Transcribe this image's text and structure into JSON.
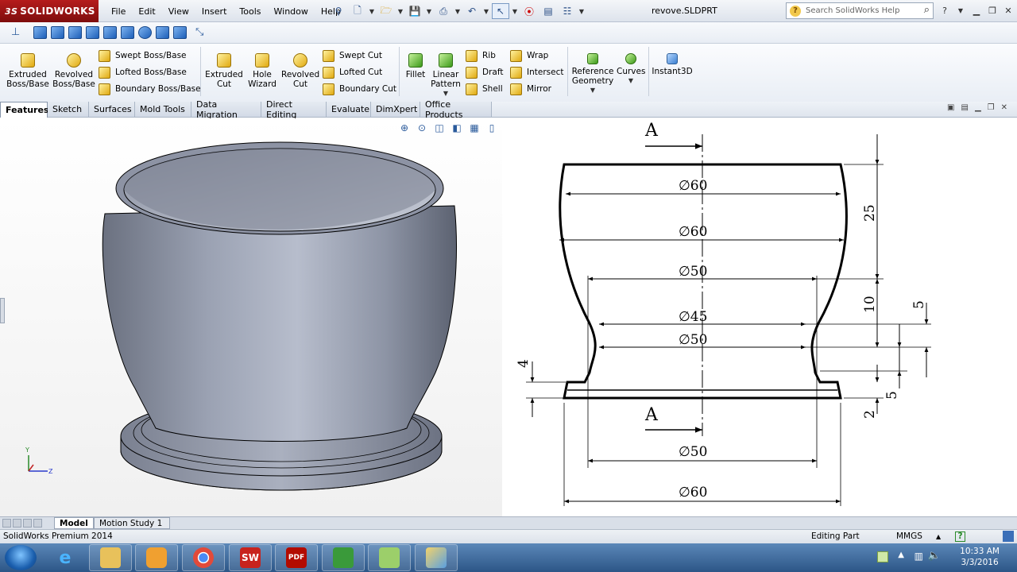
{
  "app": {
    "logo": "SOLIDWORKS",
    "logo_prefix": "3S",
    "document_title": "revove.SLDPRT",
    "search_placeholder": "Search SolidWorks Help"
  },
  "menu": [
    "File",
    "Edit",
    "View",
    "Insert",
    "Tools",
    "Window",
    "Help"
  ],
  "features_toolbar": {
    "extruded_boss": "Extruded Boss/Base",
    "revolved_boss": "Revolved Boss/Base",
    "swept_boss": "Swept Boss/Base",
    "lofted_boss": "Lofted Boss/Base",
    "boundary_boss": "Boundary Boss/Base",
    "extruded_cut": "Extruded Cut",
    "hole_wizard": "Hole Wizard",
    "revolved_cut": "Revolved Cut",
    "swept_cut": "Swept Cut",
    "lofted_cut": "Lofted Cut",
    "boundary_cut": "Boundary Cut",
    "fillet": "Fillet",
    "linear_pattern": "Linear Pattern",
    "rib": "Rib",
    "draft": "Draft",
    "shell": "Shell",
    "wrap": "Wrap",
    "intersect": "Intersect",
    "mirror": "Mirror",
    "reference_geometry": "Reference Geometry",
    "curves": "Curves",
    "instant3d": "Instant3D"
  },
  "tabs": [
    "Features",
    "Sketch",
    "Surfaces",
    "Mold Tools",
    "Data Migration",
    "Direct Editing",
    "Evaluate",
    "DimXpert",
    "Office Products"
  ],
  "drawing": {
    "section_label_top": "A",
    "section_label_bottom": "A",
    "dims": {
      "d_top": "∅60",
      "d_bulge": "∅60",
      "d_neck_upper": "∅50",
      "d_neck_min": "∅45",
      "d_neck_lower": "∅50",
      "d_base_inner": "∅50",
      "d_base_outer": "∅60",
      "h_top": "25",
      "h_mid": "10",
      "h_right": "5",
      "h_base": "5",
      "h_base_bottom": "2",
      "h_left": "4"
    }
  },
  "triad": {
    "x": "Y",
    "z": "Z"
  },
  "bottom_tabs": [
    "Model",
    "Motion Study 1"
  ],
  "status": {
    "product": "SolidWorks Premium 2014",
    "mode": "Editing Part",
    "units": "MMGS",
    "units_arrow": "▲",
    "help": "?"
  },
  "clock": {
    "time": "10:33 AM",
    "date": "3/3/2016"
  },
  "taskbar_labels": {
    "solidworks": "SW",
    "pdf": "PDF"
  }
}
